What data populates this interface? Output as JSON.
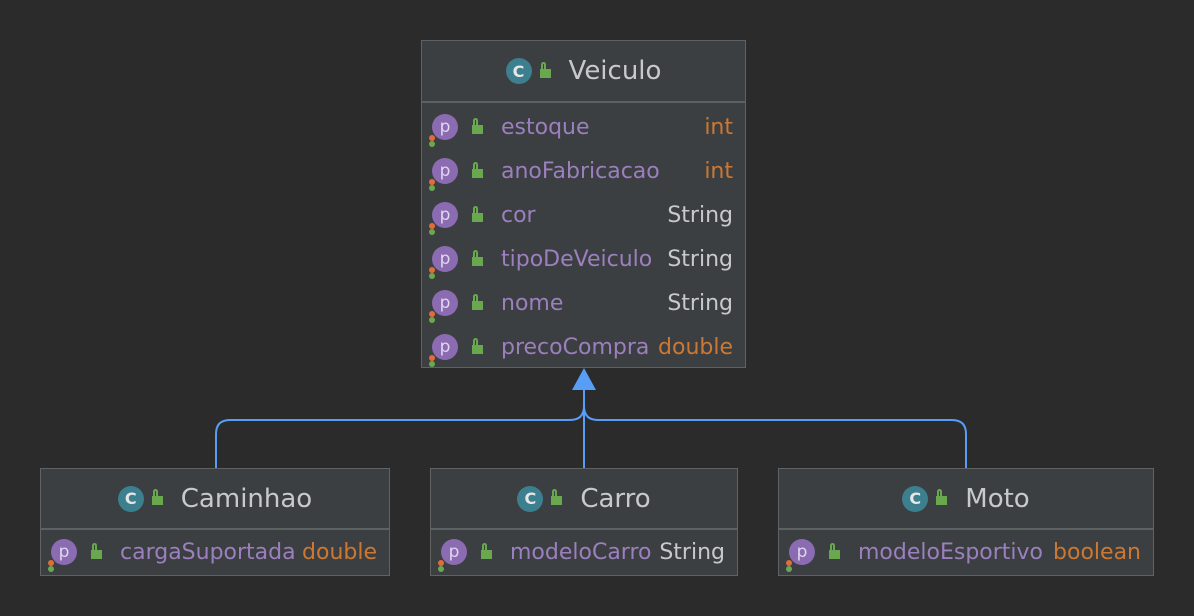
{
  "classes": {
    "veiculo": {
      "name": "Veiculo",
      "icon": "abstract-class-icon",
      "fields": [
        {
          "name": "estoque",
          "type": "int"
        },
        {
          "name": "anoFabricacao",
          "type": "int"
        },
        {
          "name": "cor",
          "type": "String"
        },
        {
          "name": "tipoDeVeiculo",
          "type": "String"
        },
        {
          "name": "nome",
          "type": "String"
        },
        {
          "name": "precoCompra",
          "type": "double"
        }
      ]
    },
    "caminhao": {
      "name": "Caminhao",
      "icon": "class-icon",
      "fields": [
        {
          "name": "cargaSuportada",
          "type": "double"
        }
      ]
    },
    "carro": {
      "name": "Carro",
      "icon": "class-icon",
      "fields": [
        {
          "name": "modeloCarro",
          "type": "String"
        }
      ]
    },
    "moto": {
      "name": "Moto",
      "icon": "class-icon",
      "fields": [
        {
          "name": "modeloEsportivo",
          "type": "boolean"
        }
      ]
    }
  },
  "icon_letters": {
    "class": "C",
    "property": "p"
  },
  "colors": {
    "background": "#2b2b2b",
    "box": "#3c3f41",
    "field_name": "#9c7fbe",
    "primitive_type": "#cc7832",
    "reference_type": "#c7c9cc",
    "inheritance_arrow": "#589df6"
  }
}
